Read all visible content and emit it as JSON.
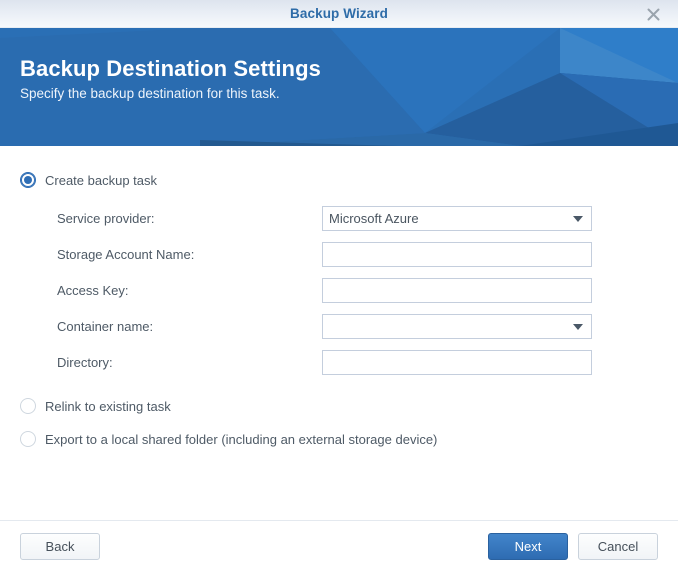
{
  "window": {
    "title": "Backup Wizard",
    "close_icon": "close-icon"
  },
  "banner": {
    "title": "Backup Destination Settings",
    "subtitle": "Specify the backup destination for this task.",
    "background_color": "#2a6fb5"
  },
  "options": [
    {
      "label": "Create backup task",
      "selected": true
    },
    {
      "label": "Relink to existing task",
      "selected": false
    },
    {
      "label": "Export to a local shared folder (including an external storage device)",
      "selected": false
    }
  ],
  "form": {
    "fields": [
      {
        "label": "Service provider:",
        "value": "Microsoft Azure",
        "type": "select",
        "placeholder": ""
      },
      {
        "label": "Storage Account Name:",
        "value": "",
        "type": "text",
        "placeholder": ""
      },
      {
        "label": "Access Key:",
        "value": "",
        "type": "text",
        "placeholder": ""
      },
      {
        "label": "Container name:",
        "value": "",
        "type": "select",
        "placeholder": ""
      },
      {
        "label": "Directory:",
        "value": "",
        "type": "text",
        "placeholder": ""
      }
    ],
    "caret_icon": "chevron-down-icon"
  },
  "footer": {
    "back_label": "Back",
    "next_label": "Next",
    "cancel_label": "Cancel",
    "primary_color": "#2e6cb2"
  }
}
